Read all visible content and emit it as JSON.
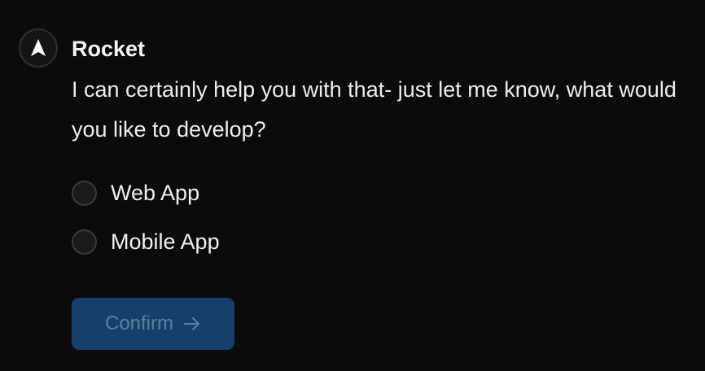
{
  "message": {
    "sender": "Rocket",
    "avatar_icon": "rocket-logo-icon",
    "text": "I can certainly help you with that- just let me know, what would you like to develop?"
  },
  "options": [
    {
      "label": "Web App",
      "selected": false
    },
    {
      "label": "Mobile App",
      "selected": false
    }
  ],
  "confirm": {
    "label": "Confirm",
    "icon": "arrow-right-icon",
    "disabled": true
  },
  "colors": {
    "background": "#0b0b0c",
    "button_bg": "#163f6b",
    "button_text": "#5f7f9f",
    "radio_border": "#3a3a3d"
  }
}
